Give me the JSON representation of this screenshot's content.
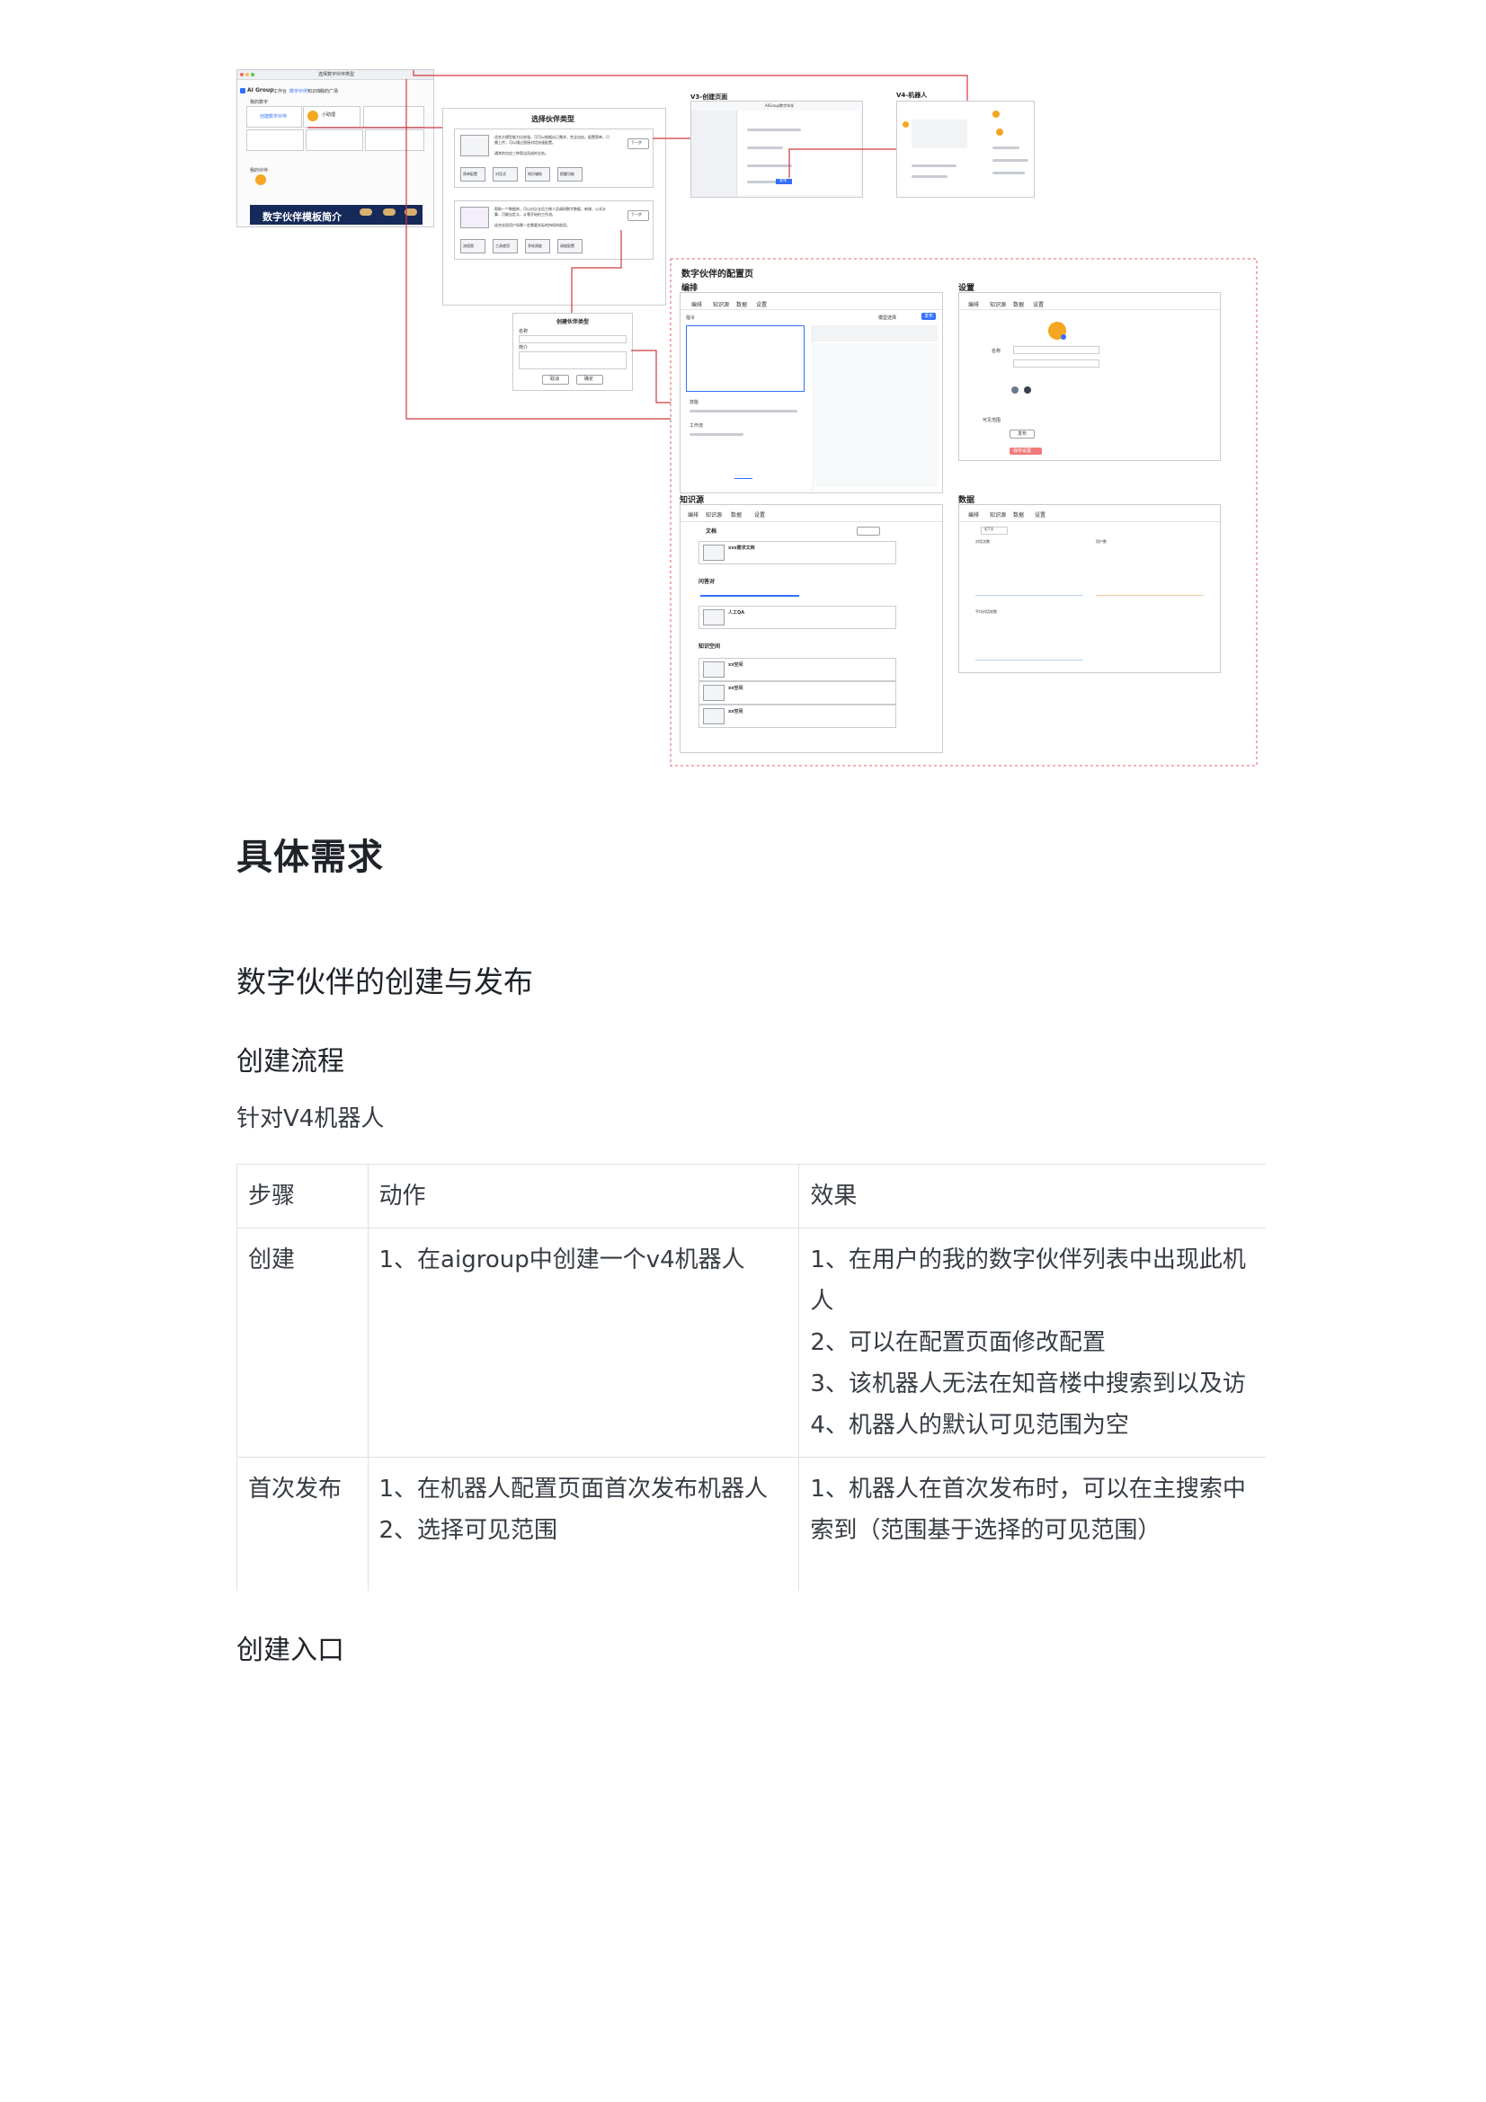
{
  "diagram": {
    "app_window": {
      "title": "选择数字伙伴类型",
      "brand": "AI Group",
      "nav": [
        "工作台",
        "数字伙伴",
        "知识库",
        "我的广场"
      ],
      "section_recommend": "我的数字",
      "create_button": "创建数字伙伴",
      "card_label": "小助理",
      "section_mine": "我的伙伴",
      "banner_text": "数字伙伴模板简介"
    },
    "select_type_panel": {
      "title": "选择伙伴类型",
      "option1_desc": "适合大模型能力比较强，可可以根据自己需求，完全自由，配置简单，只需上传，可以通过直接对话快速配置。",
      "option1_desc2": "通常的包含三种简洁而成的业务。",
      "option2_desc": "帮助一个数据库，可以对企业员工做人员调研数字数据，新增，公式计算，可能自定义，从零开始的工作流。",
      "option2_desc2": "适合实现用户场景一定需要实际的持续的助用。",
      "next_button": "下一步",
      "tags1": [
        "简单配置",
        "对话式",
        "知识辅助",
        "提醒功能"
      ],
      "tags2": [
        "流程图",
        "工具使用",
        "多轮调度",
        "调度配置"
      ]
    },
    "create_panel": {
      "title": "创建伙伴类型",
      "name_label": "名称",
      "intro_label": "简介",
      "cancel": "取消",
      "confirm": "确定"
    },
    "v3_label": "V3-创建页面",
    "v3_window_title": "AIGroup数字伙伴",
    "v3_publish_button": "发布",
    "v4_label": "V4-机器人",
    "config": {
      "title": "数字伙伴的配置页",
      "edit": "编排",
      "settings": "设置",
      "knowledge": "知识源",
      "data": "数据",
      "tabs": [
        "编排",
        "知识源",
        "数据",
        "设置"
      ],
      "prompt_label": "指令",
      "model_label": "模型选择",
      "publish": "发布",
      "save_button": "保存",
      "skill_label": "技能",
      "plugin_label": "工作流",
      "doc_label": "文档",
      "doc_file": "xxx需求文档",
      "web_label": "网页链接",
      "qa_label": "问答对",
      "qa_name": "人工QA",
      "kb_label": "知识空间",
      "kb_items": [
        "xx空间",
        "xx空间",
        "xx空间"
      ],
      "avatar_label": "名称",
      "visible_label": "可见范围",
      "publish_button": "发布",
      "save_settings": "保存设置",
      "date_selector": "近7天",
      "chart_label_1": "对话次数",
      "chart_label_2": "用户数",
      "chart_label_3": "平均对话轮数"
    }
  },
  "doc": {
    "h1": "具体需求",
    "h2": "数字伙伴的创建与发布",
    "flow_title": "创建流程",
    "flow_intro": "针对V4机器人",
    "table": {
      "headers": [
        "步骤",
        "动作",
        "效果"
      ],
      "rows": [
        {
          "step": "创建",
          "actions": [
            "1、在aigroup中创建一个v4机器人"
          ],
          "effects": [
            "1、在用户的我的数字伙伴列表中出现此机人",
            "2、可以在配置页面修改配置",
            "3、该机器人无法在知音楼中搜索到以及访",
            "4、机器人的默认可见范围为空"
          ]
        },
        {
          "step": "首次发布",
          "actions": [
            "1、在机器人配置页面首次发布机器人",
            "2、选择可见范围"
          ],
          "effects": [
            "1、机器人在首次发布时，可以在主搜索中索到（范围基于选择的可见范围）"
          ]
        }
      ]
    },
    "entry_title": "创建入口"
  }
}
